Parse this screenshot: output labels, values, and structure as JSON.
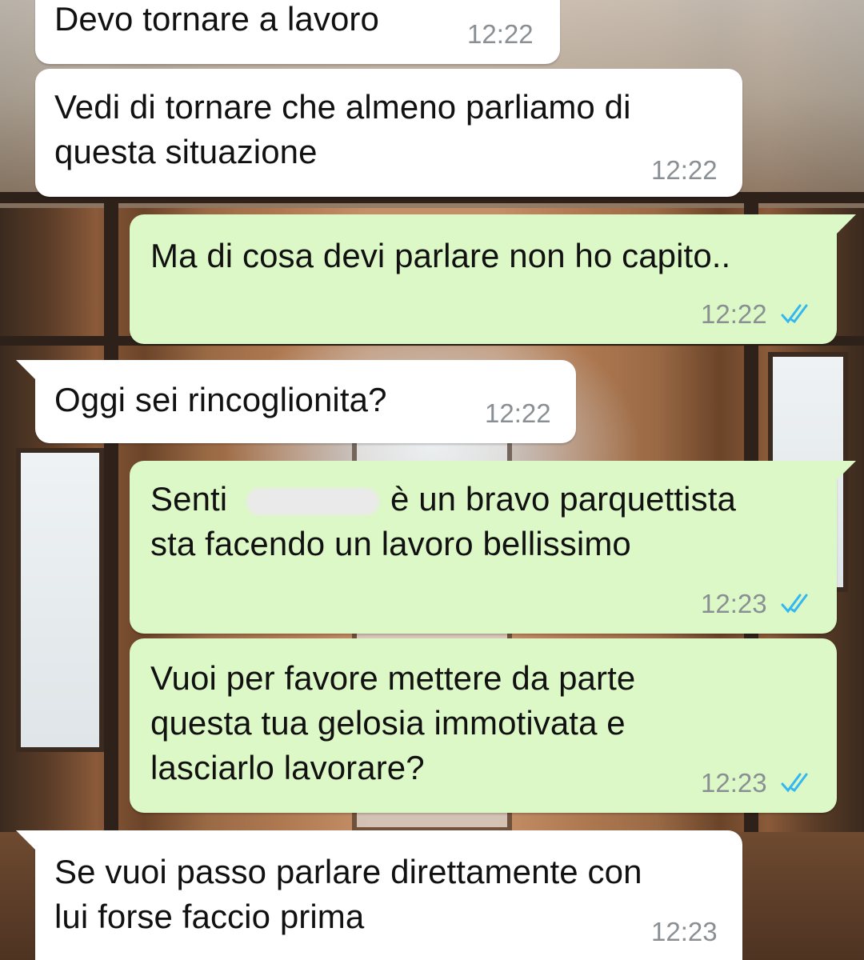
{
  "messages": [
    {
      "direction": "incoming",
      "text": "Devo tornare a lavoro",
      "time": "12:22"
    },
    {
      "direction": "incoming",
      "text": "Vedi di tornare che almeno parliamo di\nquesta situazione",
      "time": "12:22"
    },
    {
      "direction": "outgoing",
      "text": "Ma di cosa devi parlare non ho capito..",
      "time": "12:22",
      "status": "read"
    },
    {
      "direction": "incoming",
      "text": "Oggi sei rincoglionita?",
      "time": "12:22"
    },
    {
      "direction": "outgoing",
      "text_before_redaction": "Senti",
      "text_after_redaction": "è un bravo parquettista",
      "text_line2": "sta facendo un lavoro bellissimo",
      "time": "12:23",
      "status": "read"
    },
    {
      "direction": "outgoing",
      "text": "Vuoi per favore mettere da parte\nquesta tua gelosia immotivata e\nlasciarlo lavorare?",
      "time": "12:23",
      "status": "read"
    },
    {
      "direction": "incoming",
      "text": "Se vuoi passo parlare direttamente con\nlui forse faccio prima",
      "time": "12:23"
    }
  ],
  "colors": {
    "incoming_bubble": "#ffffff",
    "outgoing_bubble": "#dcf8c6",
    "timestamp": "#8a8f93",
    "read_ticks": "#34b7f1"
  },
  "icons": {
    "read_status": "double-check-icon"
  }
}
